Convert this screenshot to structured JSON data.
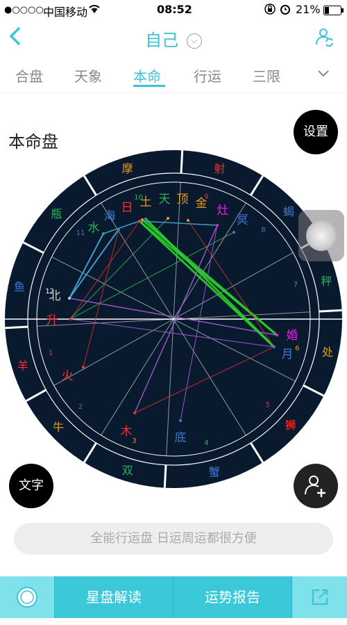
{
  "status": {
    "carrier": "中国移动",
    "signal": "●○○○○",
    "time": "08:52",
    "battery": "21%"
  },
  "nav": {
    "title": "自己"
  },
  "tabs": [
    "合盘",
    "天象",
    "本命",
    "行运",
    "三限"
  ],
  "heading": "本命盘",
  "buttons": {
    "settings": "设置",
    "text": "文字"
  },
  "chart": {
    "zodiac": [
      "射",
      "蝎",
      "秤",
      "处",
      "狮",
      "蟹",
      "双",
      "牛",
      "羊",
      "鱼",
      "瓶",
      "摩"
    ],
    "houses": [
      "9",
      "8",
      "7",
      "6",
      "5",
      "4",
      "3",
      "2",
      "1",
      "12",
      "11",
      "10"
    ],
    "planets": [
      "日",
      "土",
      "天",
      "顶",
      "金",
      "灶",
      "冥",
      "海",
      "水",
      "北",
      "升",
      "火",
      "木",
      "底",
      "婚",
      "月"
    ]
  },
  "banner": "全能行运盘 日运周运都很方便",
  "bottom": {
    "read": "星盘解读",
    "report": "运势报告"
  },
  "colors": {
    "accent": "#3cc3d6",
    "chart_bg": "#0a1a2e"
  }
}
